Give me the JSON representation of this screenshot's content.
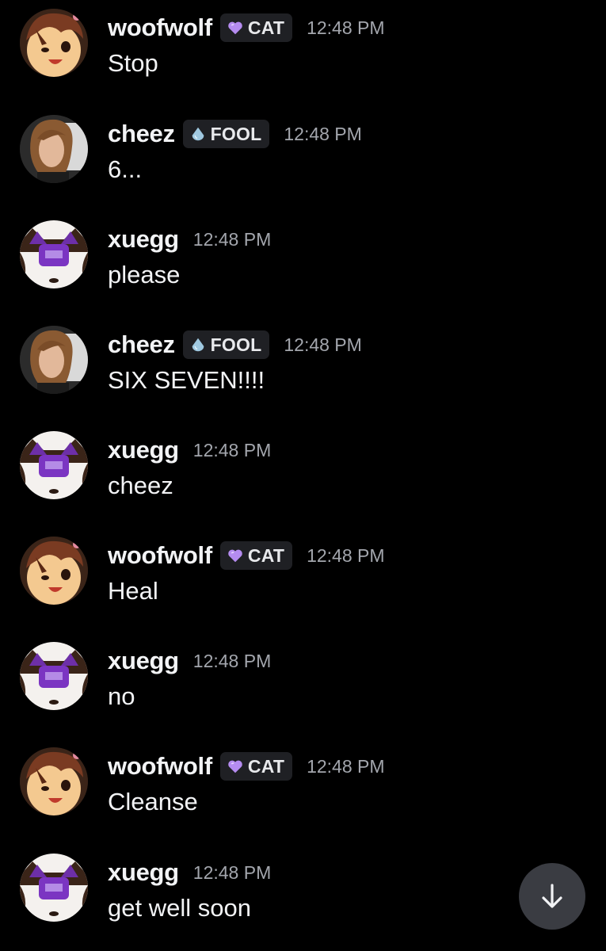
{
  "colors": {
    "background": "#000000",
    "username": "#f2f3f5",
    "timestamp": "#a3a6ad",
    "tag_background": "#1f2024",
    "cat_heart": "#b58cf0",
    "fool_drop": "#9fc8e0",
    "jump_button": "#3a3c42"
  },
  "jump_button": {
    "icon": "arrow-down-icon"
  },
  "messages": [
    {
      "author": "woofwolf",
      "tag": {
        "label": "CAT",
        "icon": "purple-heart-icon"
      },
      "time": "12:48 PM",
      "text": "Stop"
    },
    {
      "author": "cheez",
      "tag": {
        "label": "FOOL",
        "icon": "water-drop-icon"
      },
      "time": "12:48 PM",
      "text": "6..."
    },
    {
      "author": "xuegg",
      "tag": null,
      "time": "12:48 PM",
      "text": "please"
    },
    {
      "author": "cheez",
      "tag": {
        "label": "FOOL",
        "icon": "water-drop-icon"
      },
      "time": "12:48 PM",
      "text": "SIX SEVEN!!!!"
    },
    {
      "author": "xuegg",
      "tag": null,
      "time": "12:48 PM",
      "text": "cheez"
    },
    {
      "author": "woofwolf",
      "tag": {
        "label": "CAT",
        "icon": "purple-heart-icon"
      },
      "time": "12:48 PM",
      "text": "Heal"
    },
    {
      "author": "xuegg",
      "tag": null,
      "time": "12:48 PM",
      "text": "no"
    },
    {
      "author": "woofwolf",
      "tag": {
        "label": "CAT",
        "icon": "purple-heart-icon"
      },
      "time": "12:48 PM",
      "text": "Cleanse"
    },
    {
      "author": "xuegg",
      "tag": null,
      "time": "12:48 PM",
      "text": "get well soon"
    }
  ]
}
